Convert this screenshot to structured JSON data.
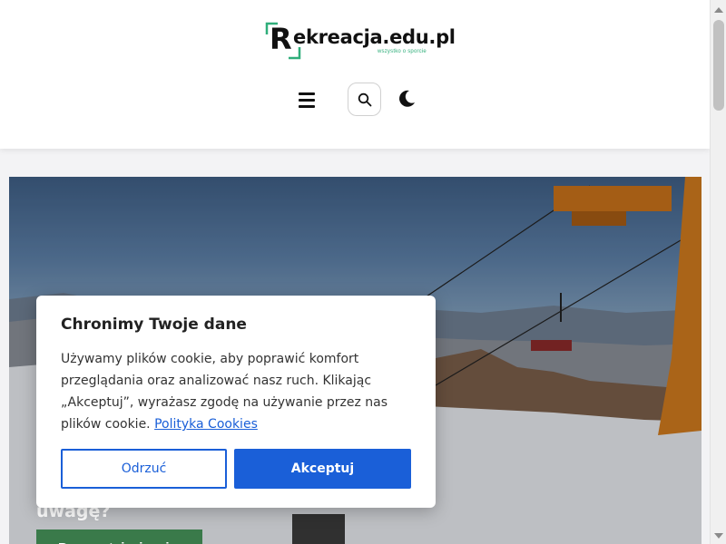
{
  "header": {
    "logo": {
      "initial": "R",
      "text": "ekreacja.edu.pl",
      "tagline": "wszystko o sporcie"
    },
    "icons": {
      "menu": "hamburger-icon",
      "search": "search-icon",
      "theme": "moon-icon"
    }
  },
  "hero": {
    "title_fragment": "uwagę?",
    "button_label": "Przeczytaj więcej"
  },
  "cookie": {
    "title": "Chronimy Twoje dane",
    "body": "Używamy plików cookie, aby poprawić komfort przeglądania oraz analizować nasz ruch. Klikając „Akceptuj”, wyrażasz zgodę na używanie przez nas plików cookie.",
    "link_label": "Polityka Cookies",
    "reject_label": "Odrzuć",
    "accept_label": "Akceptuj"
  },
  "colors": {
    "accent_blue": "#1a5fd8",
    "logo_green": "#2fae7a",
    "hero_button_green": "#3a7a4a"
  }
}
